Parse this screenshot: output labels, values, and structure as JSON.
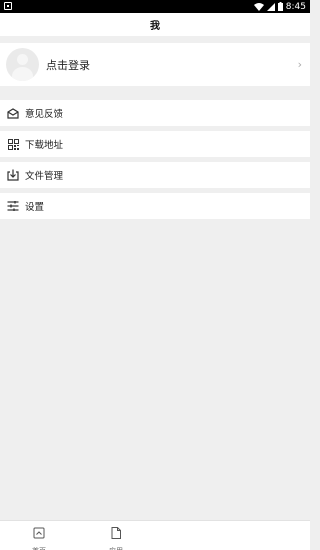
{
  "status_bar": {
    "time": "8:45"
  },
  "header": {
    "title": "我"
  },
  "login": {
    "label": "点击登录"
  },
  "menu": [
    {
      "label": "意见反馈",
      "icon": "mail-icon"
    },
    {
      "label": "下载地址",
      "icon": "qrcode-icon"
    },
    {
      "label": "文件管理",
      "icon": "download-icon"
    },
    {
      "label": "设置",
      "icon": "settings-icon"
    }
  ],
  "bottom_nav": [
    {
      "label": "首页",
      "icon": "home-icon"
    },
    {
      "label": "应用",
      "icon": "document-icon"
    }
  ]
}
